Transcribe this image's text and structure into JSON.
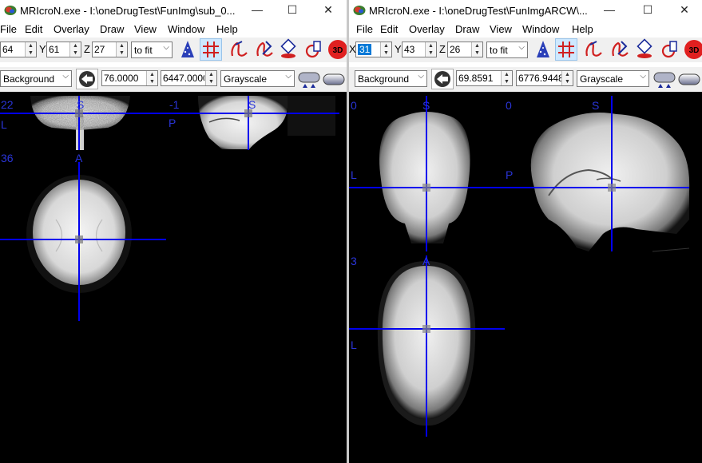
{
  "left": {
    "title": "MRIcroN.exe - I:\\oneDrugTest\\FunImg\\sub_0...",
    "menu": [
      "File",
      "Edit",
      "Overlay",
      "Draw",
      "View",
      "Window",
      "Help"
    ],
    "x_value": "64",
    "y_label": "Y",
    "y_value": "61",
    "z_label": "Z",
    "z_value": "27",
    "zoom": "to fit",
    "layer": "Background",
    "min_value": "76.0000",
    "max_value": "6447.0000",
    "colormap": "Grayscale",
    "views": {
      "coronal": {
        "slice": "22",
        "top": "S",
        "side": "L"
      },
      "sagittal": {
        "slice": "-1",
        "top": "S",
        "side": "P"
      },
      "axial": {
        "slice": "36",
        "top": "A"
      }
    }
  },
  "right": {
    "title": "MRIcroN.exe - I:\\oneDrugTest\\FunImgARCW\\...",
    "menu": [
      "File",
      "Edit",
      "Overlay",
      "Draw",
      "View",
      "Window",
      "Help"
    ],
    "x_label": "X",
    "x_value": "31",
    "y_label": "Y",
    "y_value": "43",
    "z_label": "Z",
    "z_value": "26",
    "zoom": "to fit",
    "layer": "Background",
    "min_value": "69.8591",
    "max_value": "6776.9448",
    "colormap": "Grayscale",
    "views": {
      "coronal": {
        "slice": "0",
        "top": "S",
        "side": "L"
      },
      "sagittal": {
        "slice": "0",
        "top": "S",
        "side": "P"
      },
      "axial": {
        "slice": "3",
        "top": "A",
        "side": "L"
      }
    }
  },
  "window_buttons": {
    "minimize": "—",
    "maximize": "☐",
    "close": "✕"
  },
  "colors": {
    "crosshair": "#0000ee",
    "label": "#2a35d9",
    "accent": "#0078d7"
  },
  "toolbar_icons": [
    "pen-icon",
    "crosshair-grid-icon",
    "draw-freehand-icon",
    "draw-erase-icon",
    "fill-bucket-icon",
    "overlay-icon",
    "3d-render-icon"
  ]
}
